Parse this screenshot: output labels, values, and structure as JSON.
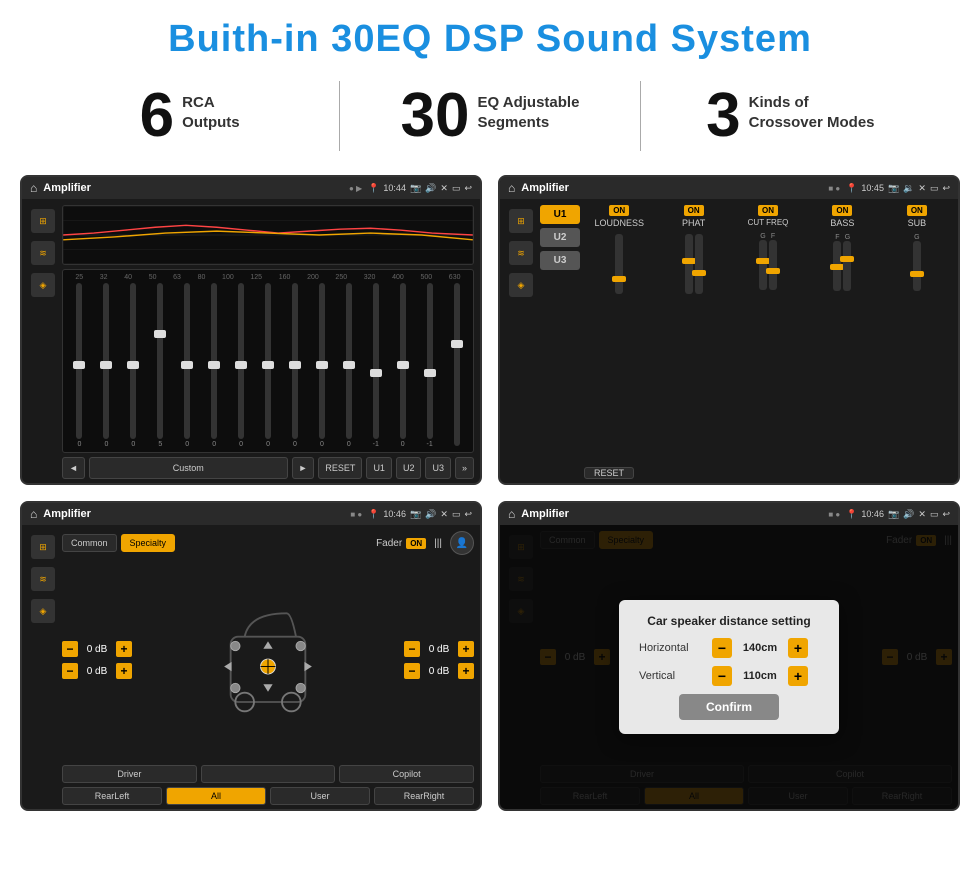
{
  "page": {
    "title": "Buith-in 30EQ DSP Sound System"
  },
  "stats": [
    {
      "number": "6",
      "label": "RCA\nOutputs"
    },
    {
      "number": "30",
      "label": "EQ Adjustable\nSegments"
    },
    {
      "number": "3",
      "label": "Kinds of\nCrossover Modes"
    }
  ],
  "screens": [
    {
      "id": "eq-screen",
      "statusBar": {
        "appName": "Amplifier",
        "time": "10:44"
      },
      "bottomButtons": [
        "◄",
        "Custom",
        "►",
        "RESET",
        "U1",
        "U2",
        "U3"
      ],
      "frequencies": [
        "25",
        "32",
        "40",
        "50",
        "63",
        "80",
        "100",
        "125",
        "160",
        "200",
        "250",
        "320",
        "400",
        "500",
        "630"
      ],
      "sliderValues": [
        "0",
        "0",
        "0",
        "5",
        "0",
        "0",
        "0",
        "0",
        "0",
        "0",
        "0",
        "-1",
        "0",
        "-1"
      ]
    },
    {
      "id": "crossover-screen",
      "statusBar": {
        "appName": "Amplifier",
        "time": "10:45"
      },
      "uButtons": [
        "U1",
        "U2",
        "U3"
      ],
      "controlLabels": [
        "LOUDNESS",
        "PHAT",
        "CUT FREQ",
        "BASS",
        "SUB"
      ],
      "resetBtn": "RESET"
    },
    {
      "id": "fader-screen",
      "statusBar": {
        "appName": "Amplifier",
        "time": "10:46"
      },
      "tabs": [
        "Common",
        "Specialty"
      ],
      "faderLabel": "Fader",
      "onBadge": "ON",
      "dbValues": [
        "0 dB",
        "0 dB",
        "0 dB",
        "0 dB"
      ],
      "bottomButtons": [
        "Driver",
        "",
        "Copilot",
        "RearLeft",
        "All",
        "User",
        "RearRight"
      ]
    },
    {
      "id": "modal-screen",
      "statusBar": {
        "appName": "Amplifier",
        "time": "10:46"
      },
      "modal": {
        "title": "Car speaker distance setting",
        "horizontal": {
          "label": "Horizontal",
          "value": "140cm"
        },
        "vertical": {
          "label": "Vertical",
          "value": "110cm"
        },
        "confirmBtn": "Confirm"
      },
      "bgDbValues": [
        "0 dB",
        "0 dB"
      ],
      "bgBottomButtons": [
        "Driver",
        "Copilot",
        "RearLeft",
        "User",
        "RearRight"
      ]
    }
  ]
}
